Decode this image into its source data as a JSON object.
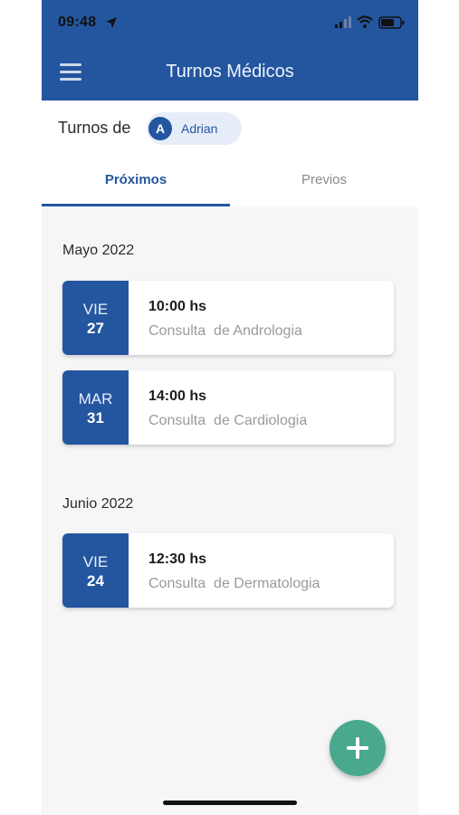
{
  "status_bar": {
    "time": "09:48",
    "icons": [
      "location-arrow-icon",
      "cellular-signal-icon",
      "wifi-icon",
      "battery-icon"
    ]
  },
  "header": {
    "title": "Turnos Médicos",
    "menu_icon": "hamburger-menu-icon"
  },
  "owner": {
    "label": "Turnos de",
    "avatar_initial": "A",
    "name": "Adrian"
  },
  "tabs": [
    {
      "label": "Próximos",
      "active": true
    },
    {
      "label": "Previos",
      "active": false
    }
  ],
  "groups": [
    {
      "title": "Mayo 2022",
      "appointments": [
        {
          "dow": "VIE",
          "day": "27",
          "time": "10:00 hs",
          "description": "Consulta  de Andrologia"
        },
        {
          "dow": "MAR",
          "day": "31",
          "time": "14:00 hs",
          "description": "Consulta  de Cardiologia"
        }
      ]
    },
    {
      "title": "Junio 2022",
      "appointments": [
        {
          "dow": "VIE",
          "day": "24",
          "time": "12:30 hs",
          "description": "Consulta  de Dermatologia"
        }
      ]
    }
  ],
  "fab": {
    "icon": "plus-icon"
  },
  "colors": {
    "primary": "#2456a0",
    "fab": "#4aa88e",
    "background": "#f6f6f7"
  }
}
